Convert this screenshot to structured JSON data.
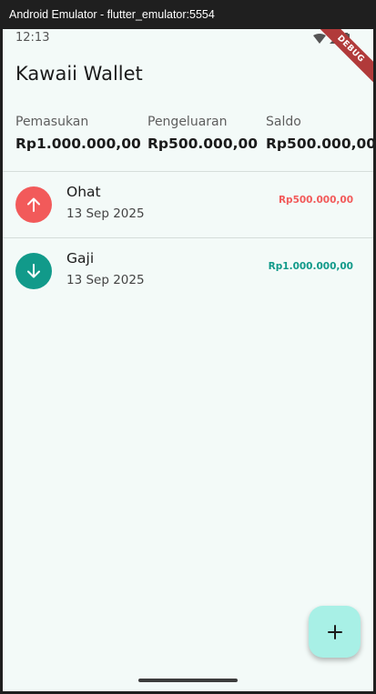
{
  "window": {
    "title": "Android Emulator - flutter_emulator:5554"
  },
  "status_bar": {
    "time": "12:13",
    "debug_label": "DEBUG"
  },
  "app": {
    "title": "Kawaii Wallet"
  },
  "summary": {
    "income_label": "Pemasukan",
    "income_value": "Rp1.000.000,00",
    "expense_label": "Pengeluaran",
    "expense_value": "Rp500.000,00",
    "balance_label": "Saldo",
    "balance_value": "Rp500.000,00"
  },
  "transactions": [
    {
      "title": "Ohat",
      "date": "13 Sep 2025",
      "amount": "Rp500.000,00",
      "kind": "expense",
      "icon": "arrow-up-icon",
      "color": "#f25a5a"
    },
    {
      "title": "Gaji",
      "date": "13 Sep 2025",
      "amount": "Rp1.000.000,00",
      "kind": "income",
      "icon": "arrow-down-icon",
      "color": "#119a8a"
    }
  ],
  "fab": {
    "icon": "plus-icon",
    "color": "#a8f0e6"
  }
}
